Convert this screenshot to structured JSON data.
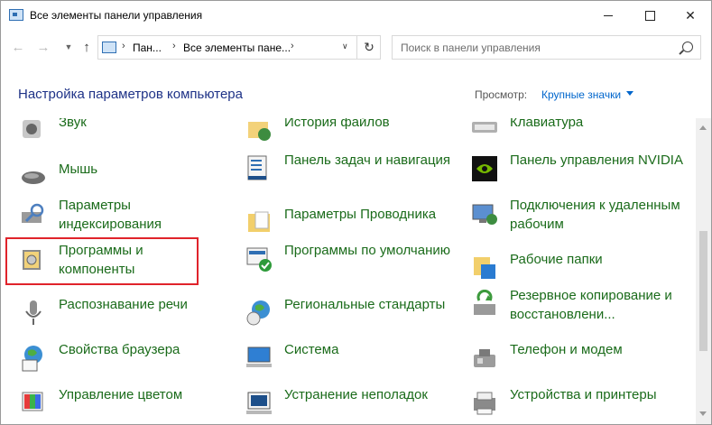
{
  "window": {
    "title": "Все элементы панели управления"
  },
  "address": {
    "crumbs": [
      "Пан...",
      "Все элементы пане..."
    ]
  },
  "search": {
    "placeholder": "Поиск в панели управления"
  },
  "header": {
    "title": "Настройка параметров компьютера",
    "view_label": "Просмотр:",
    "view_value": "Крупные значки"
  },
  "items": [
    {
      "label": "Звук",
      "icon": "speaker-icon",
      "highlighted": false
    },
    {
      "label": "История файлов",
      "icon": "file-history-icon",
      "highlighted": false
    },
    {
      "label": "Клавиатура",
      "icon": "keyboard-icon",
      "highlighted": false
    },
    {
      "label": "Мышь",
      "icon": "mouse-icon",
      "highlighted": false
    },
    {
      "label": "Панель задач и навигация",
      "icon": "taskbar-icon",
      "highlighted": false
    },
    {
      "label": "Панель управления NVIDIA",
      "icon": "nvidia-icon",
      "highlighted": false
    },
    {
      "label": "Параметры индексирования",
      "icon": "indexing-icon",
      "highlighted": false
    },
    {
      "label": "Параметры Проводника",
      "icon": "folder-options-icon",
      "highlighted": false
    },
    {
      "label": "Подключения к удаленным рабочим",
      "icon": "remote-desktop-icon",
      "highlighted": false
    },
    {
      "label": "Программы и компоненты",
      "icon": "programs-icon",
      "highlighted": true
    },
    {
      "label": "Программы по умолчанию",
      "icon": "default-programs-icon",
      "highlighted": false
    },
    {
      "label": "Рабочие папки",
      "icon": "work-folders-icon",
      "highlighted": false
    },
    {
      "label": "Распознавание речи",
      "icon": "microphone-icon",
      "highlighted": false
    },
    {
      "label": "Региональные стандарты",
      "icon": "region-icon",
      "highlighted": false
    },
    {
      "label": "Резервное копирование и восстановлени...",
      "icon": "backup-icon",
      "highlighted": false
    },
    {
      "label": "Свойства браузера",
      "icon": "internet-options-icon",
      "highlighted": false
    },
    {
      "label": "Система",
      "icon": "system-icon",
      "highlighted": false
    },
    {
      "label": "Телефон и модем",
      "icon": "phone-modem-icon",
      "highlighted": false
    },
    {
      "label": "Управление цветом",
      "icon": "color-management-icon",
      "highlighted": false
    },
    {
      "label": "Устранение неполадок",
      "icon": "troubleshooting-icon",
      "highlighted": false
    },
    {
      "label": "Устройства и принтеры",
      "icon": "devices-printers-icon",
      "highlighted": false
    }
  ]
}
